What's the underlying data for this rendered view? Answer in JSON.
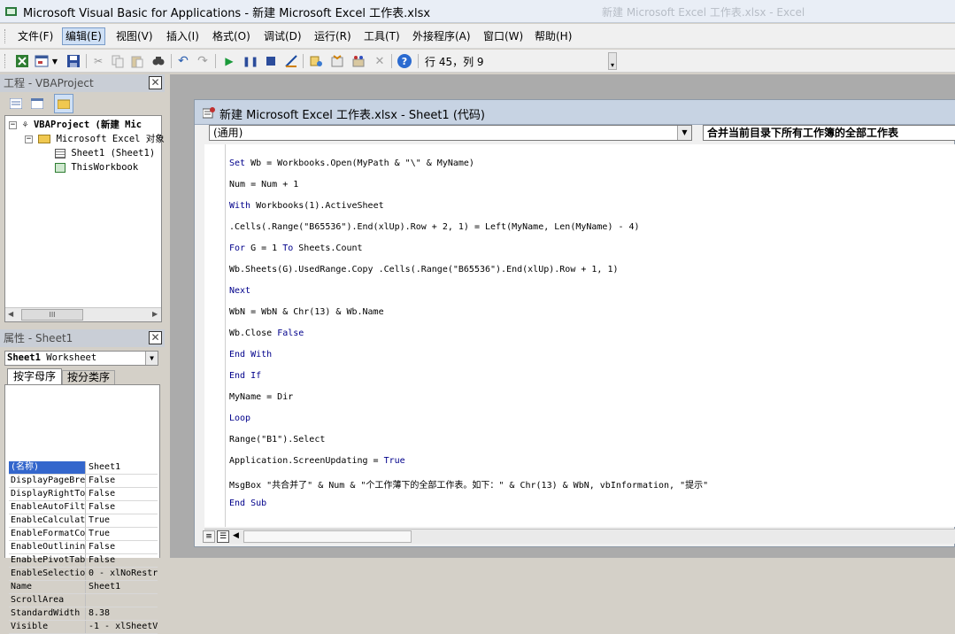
{
  "window": {
    "title": "Microsoft Visual Basic for Applications - 新建 Microsoft Excel 工作表.xlsx",
    "ghost_title": "新建 Microsoft Excel 工作表.xlsx - Excel"
  },
  "menu": [
    {
      "label": "文件(F)"
    },
    {
      "label": "编辑(E)",
      "active": true
    },
    {
      "label": "视图(V)"
    },
    {
      "label": "插入(I)"
    },
    {
      "label": "格式(O)"
    },
    {
      "label": "调试(D)"
    },
    {
      "label": "运行(R)"
    },
    {
      "label": "工具(T)"
    },
    {
      "label": "外接程序(A)"
    },
    {
      "label": "窗口(W)"
    },
    {
      "label": "帮助(H)"
    }
  ],
  "toolbar": {
    "position": "行 45，列 9"
  },
  "project": {
    "header": "工程 - VBAProject",
    "root": "VBAProject (新建 Mic",
    "folder": "Microsoft Excel 对象",
    "items": [
      "Sheet1 (Sheet1)",
      "ThisWorkbook"
    ],
    "scroll_grip": "III"
  },
  "properties": {
    "header": "属性 - Sheet1",
    "object_name": "Sheet1",
    "object_type": "Worksheet",
    "tabs": [
      "按字母序",
      "按分类序"
    ],
    "rows": [
      {
        "key": "(名称)",
        "value": "Sheet1",
        "selected": true
      },
      {
        "key": "DisplayPageBre",
        "value": "False"
      },
      {
        "key": "DisplayRightTo",
        "value": "False"
      },
      {
        "key": "EnableAutoFilt",
        "value": "False"
      },
      {
        "key": "EnableCalculat",
        "value": "True"
      },
      {
        "key": "EnableFormatCo",
        "value": "True"
      },
      {
        "key": "EnableOutlinin",
        "value": "False"
      },
      {
        "key": "EnablePivotTab",
        "value": "False"
      },
      {
        "key": "EnableSelectio",
        "value": "0 - xlNoRestr"
      },
      {
        "key": "Name",
        "value": "Sheet1"
      },
      {
        "key": "ScrollArea",
        "value": ""
      },
      {
        "key": "StandardWidth",
        "value": "8.38"
      },
      {
        "key": "Visible",
        "value": "-1 - xlSheetV"
      }
    ]
  },
  "code_window": {
    "title": "新建 Microsoft Excel 工作表.xlsx - Sheet1 (代码)",
    "object_combo": "(通用)",
    "proc_combo": "合并当前目录下所有工作簿的全部工作表",
    "lines": [
      {
        "kw": "Set",
        "rest": " Wb = Workbooks.Open(MyPath & \"\\\" & MyName)"
      },
      {
        "kw": "",
        "rest": "Num = Num + 1"
      },
      {
        "kw": "With",
        "rest": " Workbooks(1).ActiveSheet"
      },
      {
        "kw": "",
        "rest": ".Cells(.Range(\"B65536\").End(xlUp).Row + 2, 1) = Left(MyName, Len(MyName) - 4)"
      },
      {
        "kw": "For",
        "rest": " G = 1 To Sheets.Count"
      },
      {
        "kw": "",
        "rest": "Wb.Sheets(G).UsedRange.Copy .Cells(.Range(\"B65536\").End(xlUp).Row + 1, 1)"
      },
      {
        "kw": "Next",
        "rest": ""
      },
      {
        "kw": "",
        "rest": "WbN = WbN & Chr(13) & Wb.Name"
      },
      {
        "kw": "",
        "rest": "Wb.Close False"
      },
      {
        "kw": "End With",
        "rest": ""
      },
      {
        "kw": "End If",
        "rest": ""
      },
      {
        "kw": "",
        "rest": "MyName = Dir"
      },
      {
        "kw": "Loop",
        "rest": ""
      },
      {
        "kw": "",
        "rest": "Range(\"B1\").Select"
      },
      {
        "kw": "",
        "rest": "Application.ScreenUpdating = True"
      },
      {
        "kw": "",
        "rest": "MsgBox \"共合并了\" & Num & \"个工作薄下的全部工作表。如下：\" & Chr(13) & WbN, vbInformation, \"提示\""
      },
      {
        "kw": "End Sub",
        "rest": ""
      }
    ]
  }
}
